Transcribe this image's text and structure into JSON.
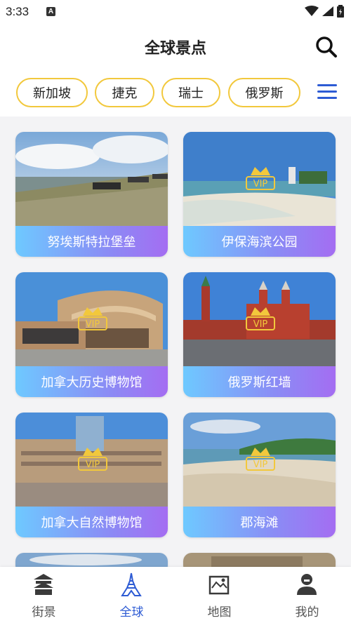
{
  "status_bar": {
    "time": "3:33",
    "notification_icon": "A"
  },
  "header": {
    "title": "全球景点",
    "search_icon": "search-icon"
  },
  "countries": [
    {
      "label": "新加坡"
    },
    {
      "label": "捷克"
    },
    {
      "label": "瑞士"
    },
    {
      "label": "俄罗斯"
    }
  ],
  "spots": [
    {
      "name": "努埃斯特拉堡垒",
      "vip": false
    },
    {
      "name": "伊保海滨公园",
      "vip": true,
      "vip_text": "VIP"
    },
    {
      "name": "加拿大历史博物馆",
      "vip": true,
      "vip_text": "VIP"
    },
    {
      "name": "俄罗斯红墙",
      "vip": true,
      "vip_text": "VIP"
    },
    {
      "name": "加拿大自然博物馆",
      "vip": true,
      "vip_text": "VIP"
    },
    {
      "name": "郡海滩",
      "vip": true,
      "vip_text": "VIP"
    }
  ],
  "tabs": [
    {
      "label": "街景",
      "icon": "temple-icon",
      "active": false
    },
    {
      "label": "全球",
      "icon": "eiffel-tower-icon",
      "active": true
    },
    {
      "label": "地图",
      "icon": "map-icon",
      "active": false
    },
    {
      "label": "我的",
      "icon": "user-icon",
      "active": false
    }
  ],
  "colors": {
    "accent": "#2d5bd4",
    "chip_border": "#f2c83c",
    "label_gradient_start": "#6ec9ff",
    "label_gradient_end": "#a46df2"
  }
}
